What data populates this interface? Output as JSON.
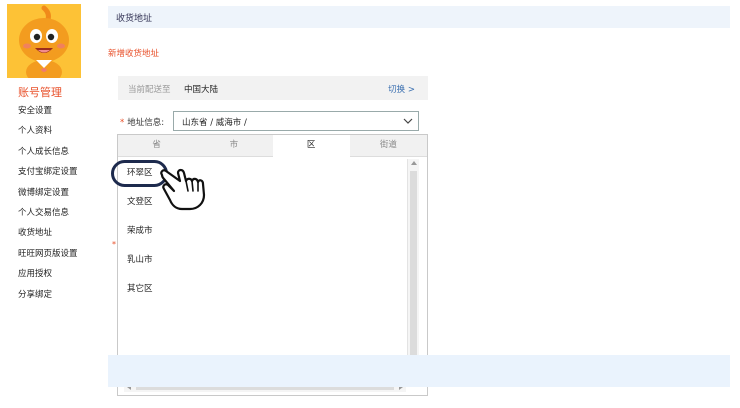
{
  "sidebar": {
    "title": "账号管理",
    "items": [
      "安全设置",
      "个人资料",
      "个人成长信息",
      "支付宝绑定设置",
      "微博绑定设置",
      "个人交易信息",
      "收货地址",
      "旺旺网页版设置",
      "应用授权",
      "分享绑定"
    ]
  },
  "header": {
    "title": "收货地址"
  },
  "add_address_link": "新增收货地址",
  "region": {
    "label": "当前配送至",
    "value": "中国大陆",
    "switch_label": "切换 >"
  },
  "address": {
    "required_mark": "*",
    "label": "地址信息:",
    "selected_value": "山东省 / 威海市 /"
  },
  "dropdown": {
    "tabs": [
      "省",
      "市",
      "区",
      "街道"
    ],
    "active_tab": "区",
    "options": [
      "环翠区",
      "文登区",
      "荣成市",
      "乳山市",
      "其它区"
    ]
  },
  "misc": {
    "stray_mark": "*"
  },
  "colors": {
    "accent": "#e8502a",
    "link": "#3a6fb0",
    "highlight": "#1d2a4d",
    "avatar_bg": "#fdc236"
  }
}
